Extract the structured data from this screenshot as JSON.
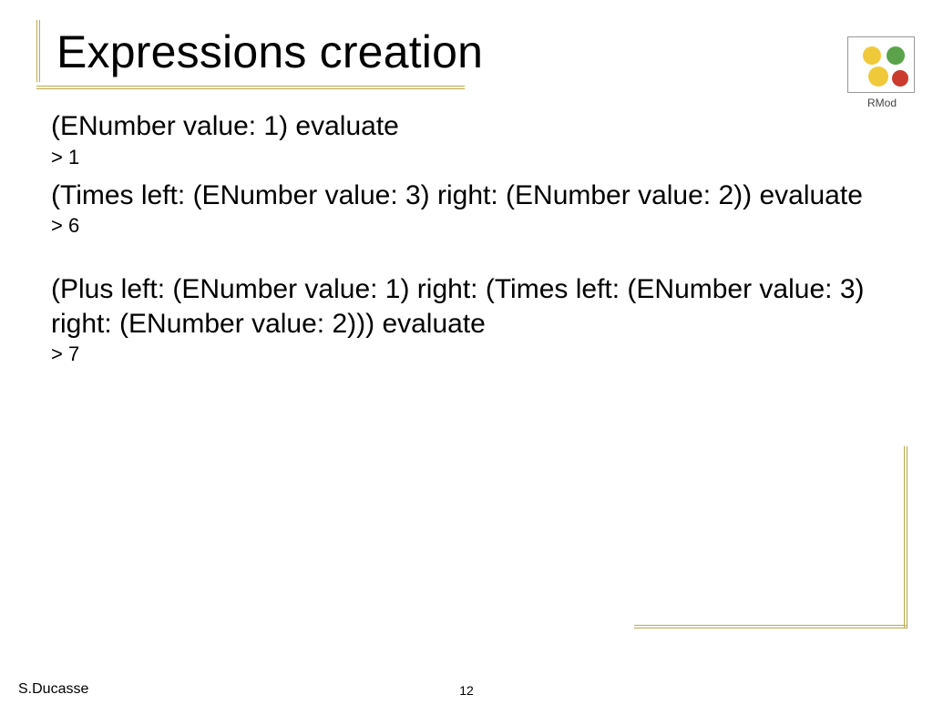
{
  "title": "Expressions creation",
  "logo": {
    "label": "RMod"
  },
  "content": {
    "expr1": "(ENumber value: 1) evaluate",
    "res1": "> 1",
    "expr2": "(Times left: (ENumber value: 3) right: (ENumber value: 2)) evaluate",
    "res2": "> 6",
    "expr3": "(Plus left: (ENumber value: 1) right: (Times left: (ENumber value: 3) right: (ENumber value: 2))) evaluate",
    "res3": "> 7"
  },
  "footer": {
    "author": "S.Ducasse",
    "page": "12"
  }
}
